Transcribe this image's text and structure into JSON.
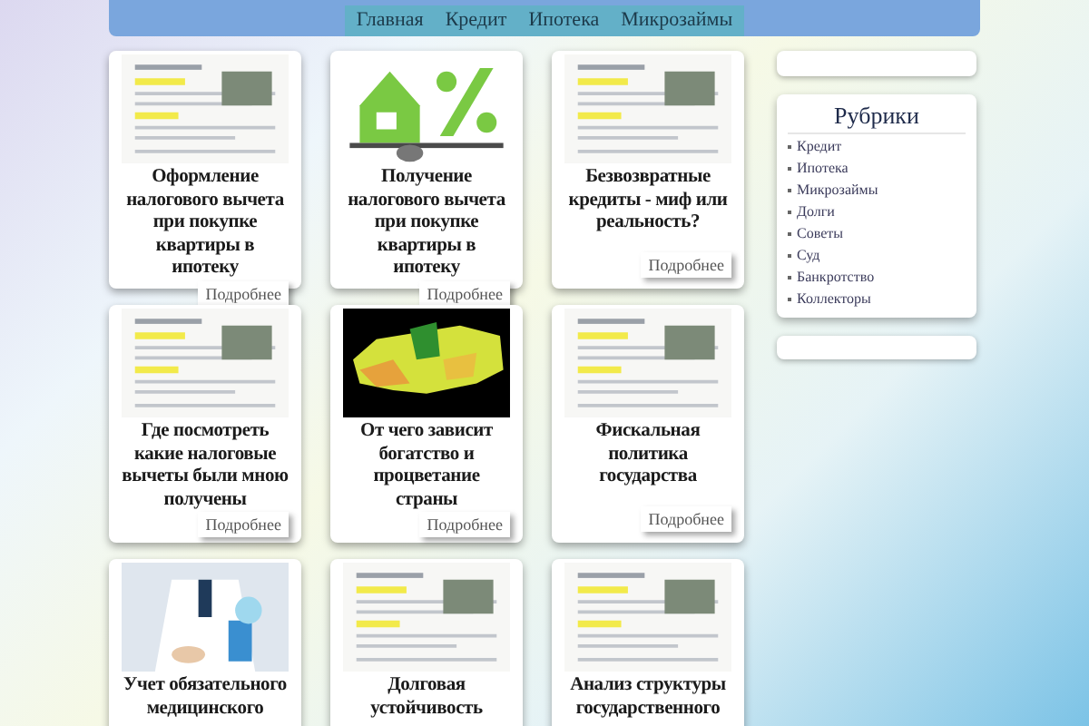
{
  "nav": {
    "items": [
      "Главная",
      "Кредит",
      "Ипотека",
      "Микрозаймы"
    ]
  },
  "cards": [
    {
      "title": "Оформление налогового вычета при покупке квартиры в ипотеку",
      "more": "Подробнее"
    },
    {
      "title": "Получение налогового вычета при покупке квартиры в ипотеку",
      "more": "Подробнее"
    },
    {
      "title": "Безвозвратные кредиты - миф или реальность?",
      "more": "Подробнее"
    },
    {
      "title": "Где посмотреть какие налоговые вычеты были мною получены",
      "more": "Подробнее"
    },
    {
      "title": "От чего зависит богатство и процветание страны",
      "more": "Подробнее"
    },
    {
      "title": "Фискальная политика государства",
      "more": "Подробнее"
    },
    {
      "title": "Учет обязательного медицинского"
    },
    {
      "title": "Долговая устойчивость"
    },
    {
      "title": "Анализ структуры государственного"
    }
  ],
  "sidebar": {
    "rubrics": {
      "title": "Рубрики",
      "items": [
        "Кредит",
        "Ипотека",
        "Микрозаймы",
        "Долги",
        "Советы",
        "Суд",
        "Банкротство",
        "Коллекторы"
      ]
    }
  }
}
